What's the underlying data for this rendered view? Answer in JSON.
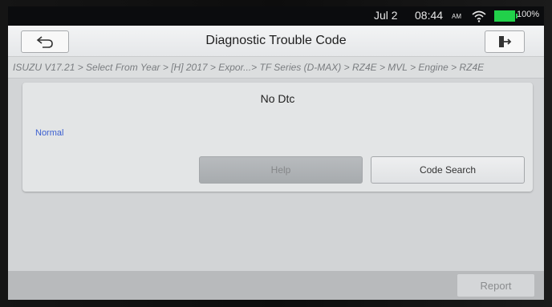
{
  "status_bar": {
    "date": "Jul 2",
    "time": "08:44",
    "ampm": "AM",
    "battery": "100%",
    "wifi_icon": "wifi-icon",
    "battery_icon": "battery-icon",
    "battery_color": "#21d14a"
  },
  "header": {
    "title": "Diagnostic Trouble Code",
    "back_icon": "back-arrow-icon",
    "exit_icon": "exit-icon"
  },
  "breadcrumb": "ISUZU V17.21 > Select From Year > [H] 2017 > Expor...> TF Series (D-MAX) > RZ4E > MVL > Engine > RZ4E",
  "panel": {
    "heading": "No Dtc",
    "status": "Normal",
    "status_color": "#3b5fd0",
    "buttons": {
      "help": "Help",
      "code_search": "Code Search"
    }
  },
  "footer": {
    "report": "Report"
  }
}
